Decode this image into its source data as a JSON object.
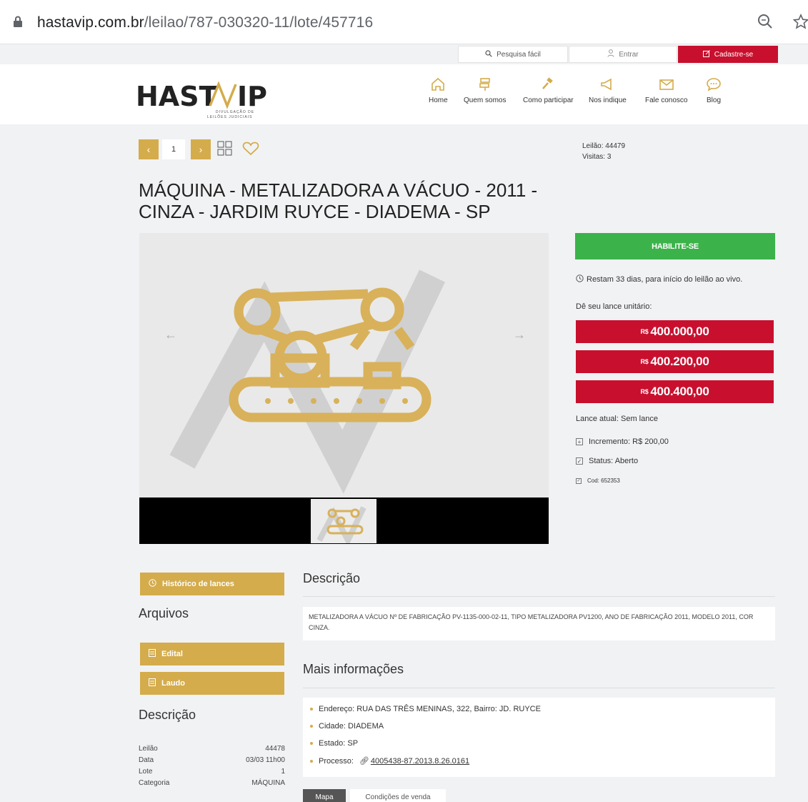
{
  "browser": {
    "url_host": "hastavip.com.br",
    "url_path": "/leilao/787-030320-11/lote/457716"
  },
  "topbar": {
    "search_label": "Pesquisa fácil",
    "login_label": "Entrar",
    "register_label": "Cadastre-se"
  },
  "header": {
    "logo_text": "HASTAVIP",
    "logo_tagline_1": "DIVULGAÇÃO DE",
    "logo_tagline_2": "LEILÕES JUDICIAIS",
    "nav": [
      {
        "label": "Home",
        "icon": "home-icon"
      },
      {
        "label": "Quem somos",
        "icon": "signpost-icon"
      },
      {
        "label": "Como participar",
        "icon": "gavel-icon"
      },
      {
        "label": "Nos indique",
        "icon": "megaphone-icon"
      },
      {
        "label": "Fale conosco",
        "icon": "envelope-icon"
      },
      {
        "label": "Blog",
        "icon": "chat-bubble-icon"
      }
    ]
  },
  "lot": {
    "pager_current": "1",
    "leilao_line": "Leilão: 44479",
    "visitas_line": "Visitas: 3",
    "title": "MÁQUINA - METALIZADORA A VÁCUO - 2011 - CINZA - JARDIM RUYCE - DIADEMA - SP"
  },
  "bidding": {
    "habilite_label": "HABILITE-SE",
    "countdown": "Restam 33 dias, para início do leilão ao vivo.",
    "prompt": "Dê seu lance unitário:",
    "currency": "R$",
    "bids": [
      "400.000,00",
      "400.200,00",
      "400.400,00"
    ],
    "current_bid": "Lance atual: Sem lance",
    "increment": "Incremento: R$ 200,00",
    "status": "Status: Aberto",
    "code": "Cod: 652353"
  },
  "sidebar": {
    "history_button": "Histórico de lances",
    "files_heading": "Arquivos",
    "files": [
      "Edital",
      "Laudo"
    ],
    "desc_heading": "Descrição",
    "details": [
      {
        "label": "Leilão",
        "value": "44478"
      },
      {
        "label": "Data",
        "value": "03/03 11h00"
      },
      {
        "label": "Lote",
        "value": "1"
      },
      {
        "label": "Categoria",
        "value": "MÁQUINA"
      }
    ]
  },
  "main": {
    "desc_heading": "Descrição",
    "desc_text": "METALIZADORA A VÁCUO Nº DE FABRICAÇÃO PV-1135-000-02-11, TIPO METALIZADORA PV1200, ANO DE FABRICAÇÃO 2011, MODELO 2011, COR CINZA.",
    "more_heading": "Mais informações",
    "address": "Endereço: RUA DAS TRÊS MENINAS, 322, Bairro: JD. RUYCE",
    "city": "Cidade: DIADEMA",
    "state": "Estado: SP",
    "process_label": "Processo:",
    "process_link": "4005438-87.2013.8.26.0161",
    "tabs": [
      "Mapa",
      "Condições de venda"
    ]
  }
}
